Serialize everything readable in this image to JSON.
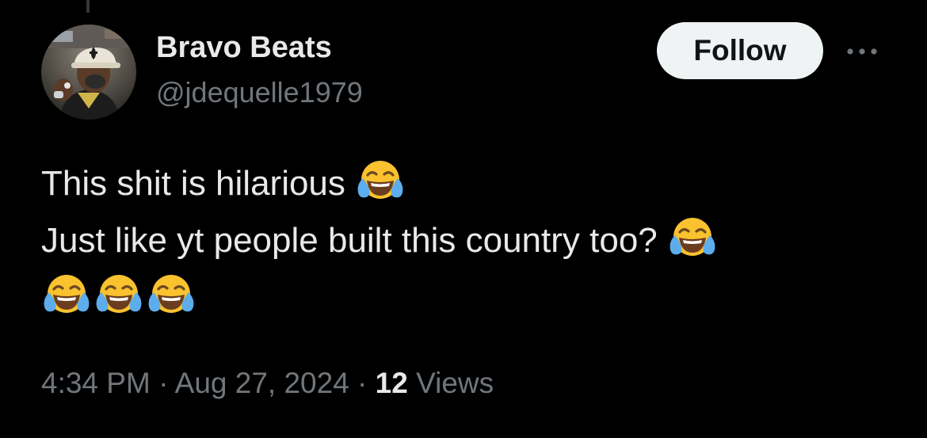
{
  "author": {
    "display_name": "Bravo Beats",
    "handle": "@jdequelle1979"
  },
  "actions": {
    "follow_label": "Follow",
    "more_icon": "more-horizontal-icon"
  },
  "tweet": {
    "line1_text": "This shit is hilarious ",
    "line2_text": "Just like yt people built this country too? ",
    "emoji_name": "face-with-tears-of-joy-icon",
    "line1_emoji_count": 1,
    "line2_emoji_count": 1,
    "line3_emoji_count": 3
  },
  "meta": {
    "time": "4:34 PM",
    "separator1": " · ",
    "date": "Aug 27, 2024",
    "separator2": " · ",
    "views_count": "12",
    "views_label": " Views"
  },
  "colors": {
    "background": "#000000",
    "primary_text": "#e7e9ea",
    "secondary_text": "#71767b",
    "follow_button_bg": "#eff3f4",
    "follow_button_text": "#0f1419",
    "emoji_face": "#f9c22e",
    "emoji_tears": "#5dadec"
  }
}
